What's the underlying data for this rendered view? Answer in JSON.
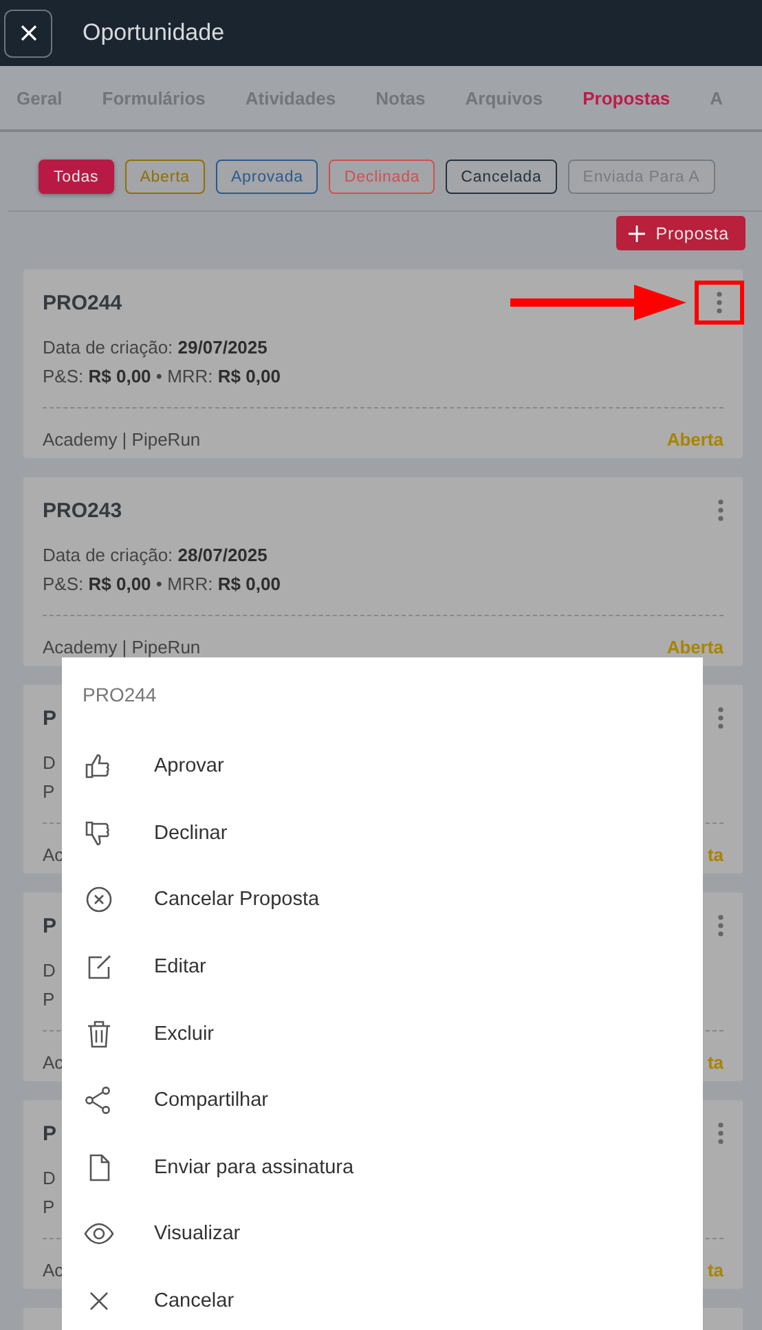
{
  "header": {
    "title": "Oportunidade"
  },
  "tabs": [
    {
      "label": "Geral",
      "selected": false
    },
    {
      "label": "Formulários",
      "selected": false
    },
    {
      "label": "Atividades",
      "selected": false
    },
    {
      "label": "Notas",
      "selected": false
    },
    {
      "label": "Arquivos",
      "selected": false
    },
    {
      "label": "Propostas",
      "selected": true
    },
    {
      "label": "A",
      "selected": false
    }
  ],
  "filters": [
    {
      "label": "Todas",
      "selected": true,
      "color": "#b81a45"
    },
    {
      "label": "Aberta",
      "selected": false,
      "color": "#8f7000"
    },
    {
      "label": "Aprovada",
      "selected": false,
      "color": "#2b5a8c"
    },
    {
      "label": "Declinada",
      "selected": false,
      "color": "#d05050"
    },
    {
      "label": "Cancelada",
      "selected": false,
      "color": "#26313c"
    },
    {
      "label": "Enviada Para A",
      "selected": false,
      "color": "#777b80"
    }
  ],
  "add_button": {
    "label": "Proposta"
  },
  "proposals": [
    {
      "code": "PRO244",
      "date_label": "Data de criação:",
      "date": "29/07/2025",
      "ps_label": "P&S:",
      "ps": "R$ 0,00",
      "sep": "•",
      "mrr_label": "MRR:",
      "mrr": "R$ 0,00",
      "company": "Academy | PipeRun",
      "status": "Aberta",
      "highlighted": true
    },
    {
      "code": "PRO243",
      "date_label": "Data de criação:",
      "date": "28/07/2025",
      "ps_label": "P&S:",
      "ps": "R$ 0,00",
      "sep": "•",
      "mrr_label": "MRR:",
      "mrr": "R$ 0,00",
      "company": "Academy | PipeRun",
      "status": "Aberta",
      "highlighted": false
    },
    {
      "code": "P",
      "date_label": "D",
      "ps_label": "P",
      "company": "Ac",
      "status": "ta",
      "highlighted": false
    },
    {
      "code": "P",
      "date_label": "D",
      "ps_label": "P",
      "company": "Ac",
      "status": "ta",
      "highlighted": false
    },
    {
      "code": "P",
      "date_label": "D",
      "ps_label": "P",
      "company": "Ac",
      "status": "ta",
      "highlighted": false
    },
    {
      "highlighted": false
    }
  ],
  "action_menu": {
    "title": "PRO244",
    "items": [
      {
        "kind": "approve",
        "label": "Aprovar"
      },
      {
        "kind": "decline",
        "label": "Declinar"
      },
      {
        "kind": "cancel-proposal",
        "label": "Cancelar Proposta"
      },
      {
        "kind": "edit",
        "label": "Editar"
      },
      {
        "kind": "delete",
        "label": "Excluir"
      },
      {
        "kind": "share",
        "label": "Compartilhar"
      },
      {
        "kind": "sign",
        "label": "Enviar para assinatura"
      },
      {
        "kind": "view",
        "label": "Visualizar"
      },
      {
        "kind": "close",
        "label": "Cancelar"
      }
    ]
  }
}
